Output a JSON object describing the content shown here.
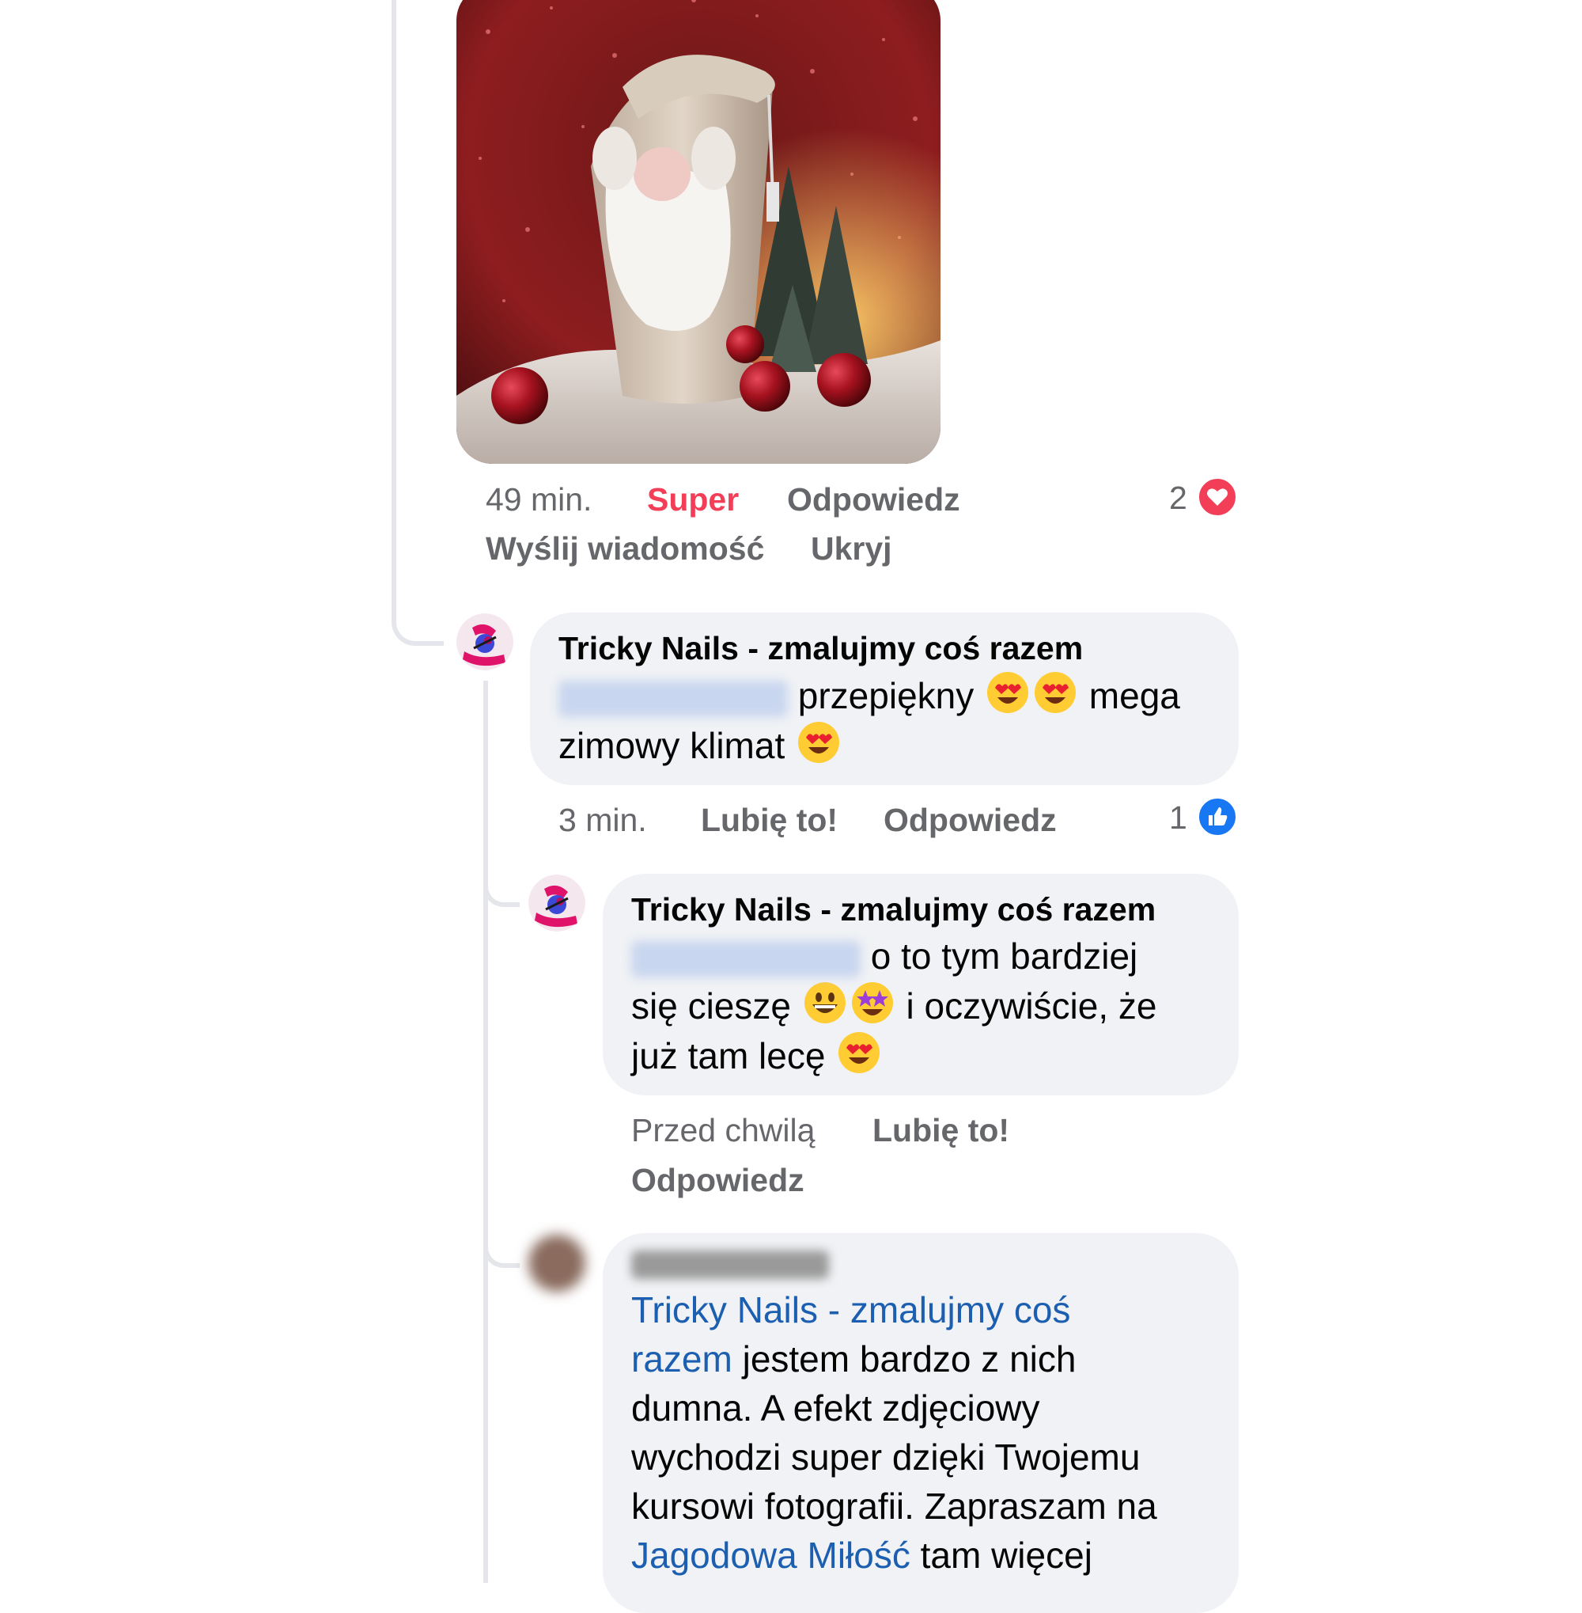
{
  "post_meta": {
    "time": "49 min.",
    "reaction": "Super",
    "reply": "Odpowiedz",
    "send_message": "Wyślij wiadomość",
    "hide": "Ukryj",
    "reaction_count": "2",
    "reaction_icon": "heart-icon"
  },
  "comment1": {
    "author": "Tricky Nails - zmalujmy coś razem",
    "text_a": "przepiękny",
    "text_b": "mega",
    "text_c": "zimowy klimat",
    "time": "3 min.",
    "like": "Lubię to!",
    "reply": "Odpowiedz",
    "reaction_count": "1",
    "reaction_icon": "like-icon"
  },
  "comment2": {
    "author": "Tricky Nails - zmalujmy coś razem",
    "text_a": "o to tym bardziej",
    "text_b": "się cieszę",
    "text_c": "i oczywiście, że",
    "text_d": "już tam lecę",
    "time": "Przed chwilą",
    "like": "Lubię to!",
    "reply": "Odpowiedz"
  },
  "comment3": {
    "mention1_a": "Tricky Nails - zmalujmy coś",
    "mention1_b": "razem",
    "line1_rest": "jestem bardzo z nich",
    "line2": "dumna. A efekt zdjęciowy",
    "line3": "wychodzi super dzięki Twojemu",
    "line4": "kursowi fotografii. Zapraszam na",
    "mention2": "Jagodowa Miłość",
    "line5_rest": " tam więcej"
  },
  "colors": {
    "accent_like": "#1877f2",
    "accent_love": "#f33e58",
    "bubble": "#f0f2f5",
    "mention": "#1c5fb0"
  }
}
